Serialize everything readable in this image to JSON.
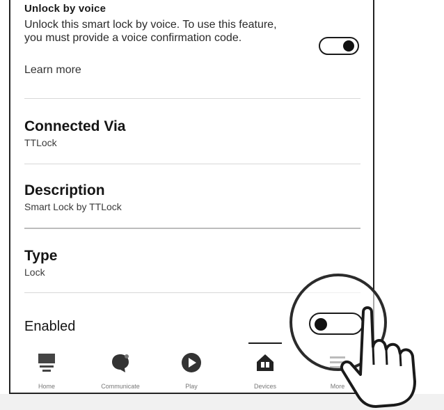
{
  "unlock_by_voice": {
    "title": "Unlock by voice",
    "description": "Unlock this smart lock by voice. To use this feature, you must provide a voice confirmation code.",
    "learn_more": "Learn more",
    "toggle_on": true
  },
  "connected_via": {
    "title": "Connected Via",
    "value": "TTLock"
  },
  "description": {
    "title": "Description",
    "value": "Smart Lock by TTLock"
  },
  "type": {
    "title": "Type",
    "value": "Lock"
  },
  "enabled": {
    "title": "Enabled",
    "toggle_on": false
  },
  "tabs": [
    {
      "label": "Home",
      "icon": "home-icon"
    },
    {
      "label": "Communicate",
      "icon": "chat-bubble-icon"
    },
    {
      "label": "Play",
      "icon": "play-icon"
    },
    {
      "label": "Devices",
      "icon": "devices-house-icon",
      "active": true
    },
    {
      "label": "More",
      "icon": "menu-icon"
    }
  ],
  "colors": {
    "text": "#1a1a1a",
    "divider": "#d8d8d8",
    "toggle": "#111111"
  }
}
